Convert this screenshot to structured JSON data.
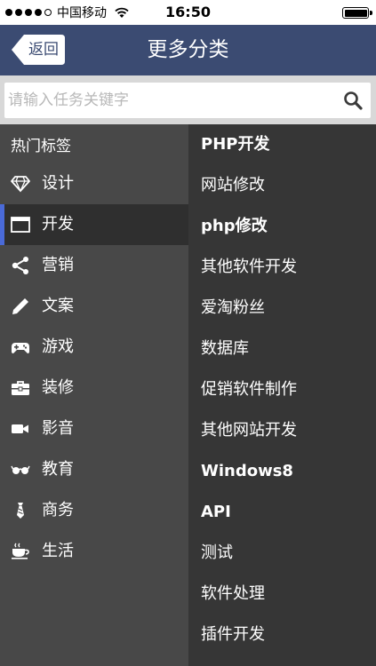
{
  "status_bar": {
    "carrier": "中国移动",
    "time": "16:50",
    "signal_bars": 4,
    "signal_total": 5,
    "battery_level": 1.0
  },
  "nav": {
    "back_label": "返回",
    "title": "更多分类",
    "bg_color": "#3b4b72"
  },
  "search": {
    "placeholder": "请输入任务关键字",
    "value": ""
  },
  "sidebar": {
    "header": "热门标签",
    "active_index": 1,
    "accent_color": "#4a6ad8",
    "items": [
      {
        "label": "设计",
        "icon": "diamond-icon"
      },
      {
        "label": "开发",
        "icon": "browser-window-icon"
      },
      {
        "label": "营销",
        "icon": "share-icon"
      },
      {
        "label": "文案",
        "icon": "pencil-icon"
      },
      {
        "label": "游戏",
        "icon": "gamepad-icon"
      },
      {
        "label": "装修",
        "icon": "toolbox-icon"
      },
      {
        "label": "影音",
        "icon": "video-camera-icon"
      },
      {
        "label": "教育",
        "icon": "glasses-icon"
      },
      {
        "label": "商务",
        "icon": "necktie-icon"
      },
      {
        "label": "生活",
        "icon": "coffee-cup-icon"
      }
    ]
  },
  "subcategories": [
    {
      "label": "PHP开发"
    },
    {
      "label": "网站修改"
    },
    {
      "label": "php修改"
    },
    {
      "label": "其他软件开发"
    },
    {
      "label": "爱淘粉丝"
    },
    {
      "label": "数据库"
    },
    {
      "label": "促销软件制作"
    },
    {
      "label": "其他网站开发"
    },
    {
      "label": "Windows8"
    },
    {
      "label": "API"
    },
    {
      "label": "测试"
    },
    {
      "label": "软件处理"
    },
    {
      "label": "插件开发"
    }
  ]
}
